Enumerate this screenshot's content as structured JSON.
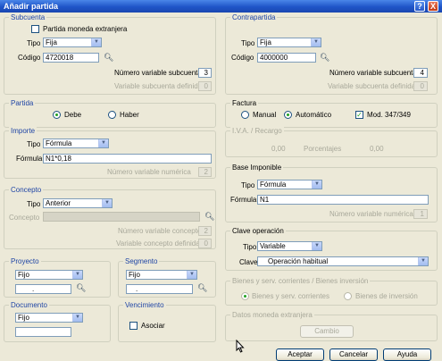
{
  "window": {
    "title": "Añadir partida",
    "help_glyph": "?",
    "close_glyph": "X"
  },
  "subcuenta": {
    "legend": "Subcuenta",
    "moneda_extranjera_label": "Partida moneda extranjera",
    "tipo_label": "Tipo",
    "tipo_value": "Fija",
    "codigo_label": "Código",
    "codigo_value": "4720018",
    "num_var_label": "Número variable subcuenta",
    "num_var_value": "3",
    "var_def_label": "Variable subcuenta definida",
    "var_def_value": "0"
  },
  "contrapartida": {
    "legend": "Contrapartida",
    "tipo_label": "Tipo",
    "tipo_value": "Fija",
    "codigo_label": "Código",
    "codigo_value": "4000000",
    "num_var_label": "Número variable subcuenta",
    "num_var_value": "4",
    "var_def_label": "Variable subcuenta definida",
    "var_def_value": "0"
  },
  "partida": {
    "legend": "Partida",
    "debe_label": "Debe",
    "haber_label": "Haber",
    "selected": "Debe"
  },
  "factura": {
    "legend": "Factura",
    "manual_label": "Manual",
    "automatico_label": "Automático",
    "selected": "Automático",
    "mod_label": "Mod. 347/349",
    "mod_checked": true
  },
  "importe": {
    "legend": "Importe",
    "tipo_label": "Tipo",
    "tipo_value": "Fórmula",
    "formula_label": "Fórmula",
    "formula_value": "N1*0,18",
    "num_var_label": "Número variable numérica",
    "num_var_value": "2"
  },
  "iva": {
    "legend": "I.V.A. / Recargo",
    "value1": "0,00",
    "porcentajes_label": "Porcentajes",
    "value2": "0,00"
  },
  "base": {
    "legend": "Base Imponible",
    "tipo_label": "Tipo",
    "tipo_value": "Fórmula",
    "formula_label": "Fórmula",
    "formula_value": "N1",
    "num_var_label": "Número variable numérica",
    "num_var_value": "1"
  },
  "concepto": {
    "legend": "Concepto",
    "tipo_label": "Tipo",
    "tipo_value": "Anterior",
    "concepto_label": "Concepto",
    "num_var_label": "Número variable concepto",
    "num_var_value": "2",
    "var_def_label": "Variable concepto definida",
    "var_def_value": "0"
  },
  "clave": {
    "legend": "Clave operación",
    "tipo_label": "Tipo",
    "tipo_value": "Variable",
    "clave_label": "Clave",
    "clave_value": "Operación habitual"
  },
  "proyecto": {
    "legend": "Proyecto",
    "tipo_value": "Fijo",
    "field_value": "."
  },
  "segmento": {
    "legend": "Segmento",
    "tipo_value": "Fijo",
    "field_value": "."
  },
  "bienes": {
    "legend": "Bienes y serv. corrientes / Bienes inversión",
    "option1": "Bienes y serv. corrientes",
    "option2": "Bienes de inversión"
  },
  "documento": {
    "legend": "Documento",
    "tipo_value": "Fijo"
  },
  "vencimiento": {
    "legend": "Vencimiento",
    "asociar_label": "Asociar"
  },
  "datos_moneda": {
    "legend": "Datos moneda extranjera",
    "cambio_label": "Cambio"
  },
  "footer": {
    "aceptar_label": "Aceptar",
    "cancelar_label": "Cancelar",
    "ayuda_label": "Ayuda"
  }
}
